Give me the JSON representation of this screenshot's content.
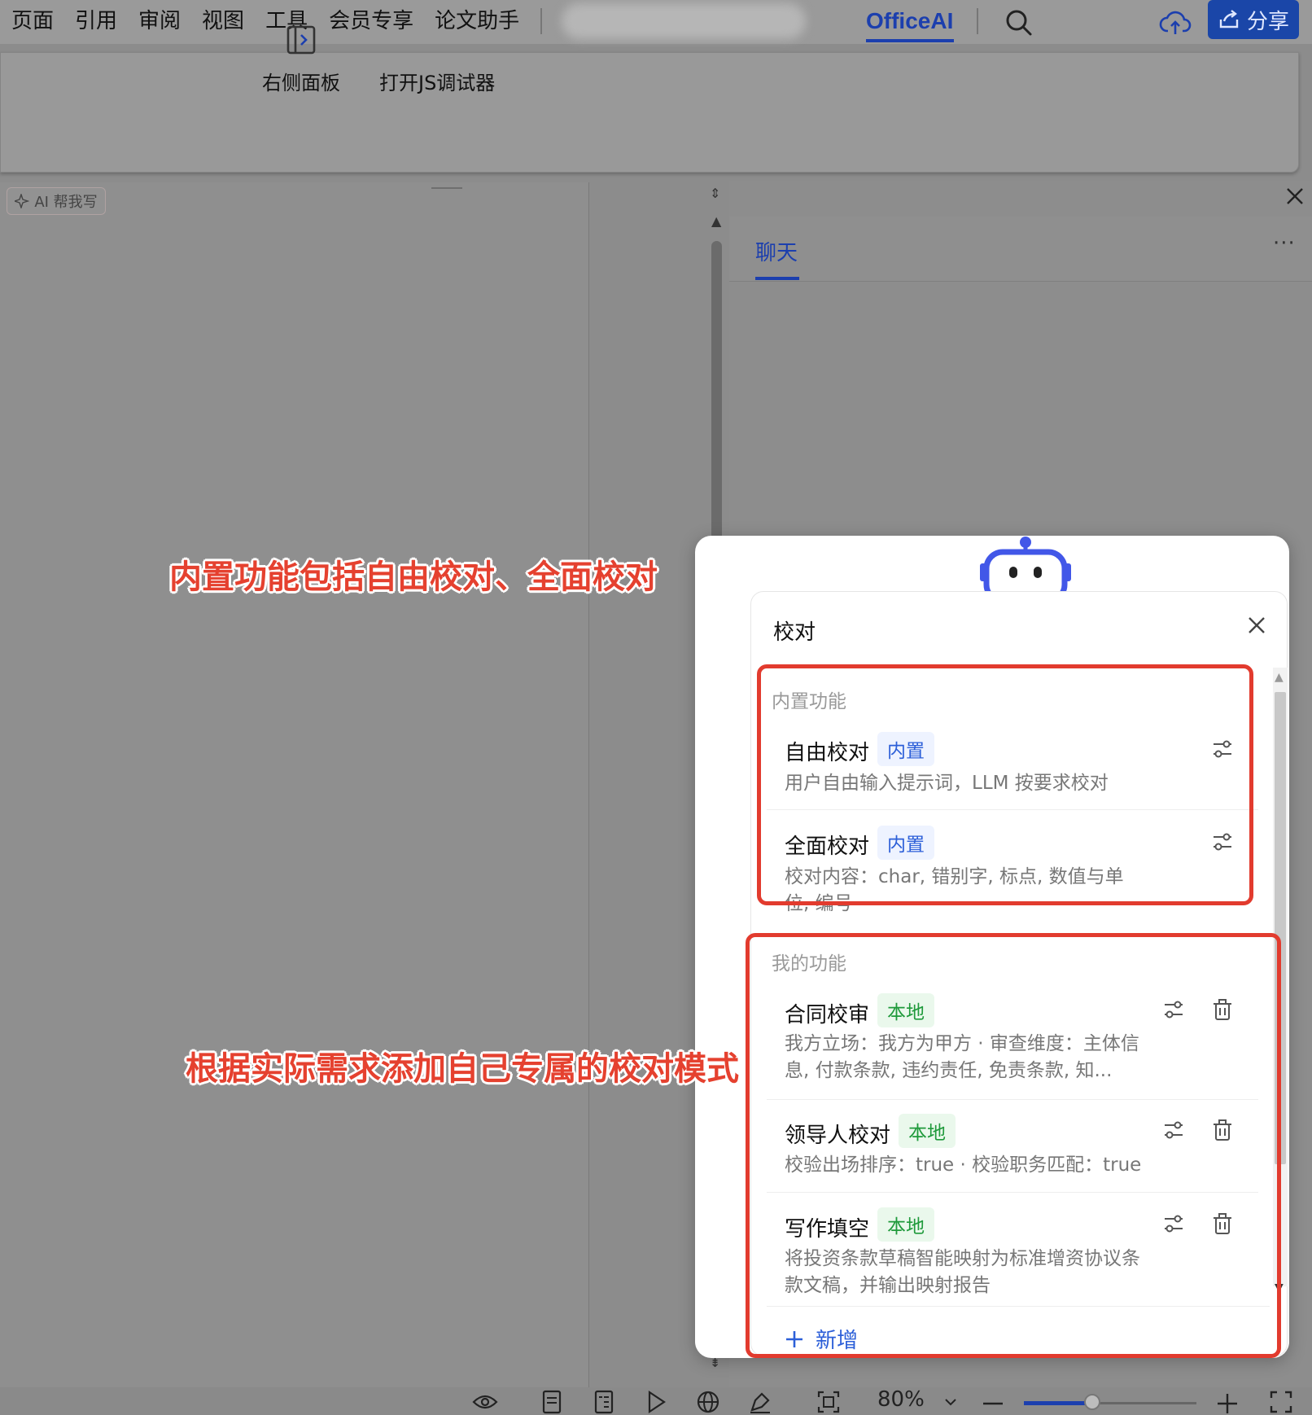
{
  "menubar": {
    "items": [
      "页面",
      "引用",
      "审阅",
      "视图",
      "工具",
      "会员专享",
      "论文助手"
    ],
    "active_tab": "OfficeAI",
    "share_label": "分享"
  },
  "ribbon": {
    "right_panel_label": "右侧面板",
    "js_debugger_label": "打开JS调试器"
  },
  "document": {
    "ai_write_label": "AI 帮我写"
  },
  "side_panel": {
    "chat_tab": "聊天",
    "more": "···"
  },
  "dialog": {
    "title": "校对",
    "builtin_section": "内置功能",
    "builtin_items": [
      {
        "name": "自由校对",
        "tag": "内置",
        "desc": "用户自由输入提示词，LLM 按要求校对"
      },
      {
        "name": "全面校对",
        "tag": "内置",
        "desc": "校对内容：char, 错别字, 标点, 数值与单位, 编号"
      }
    ],
    "mine_section": "我的功能",
    "mine_items": [
      {
        "name": "合同校审",
        "tag": "本地",
        "desc": "我方立场：我方为甲方 · 审查维度：主体信息, 付款条款, 违约责任, 免责条款, 知..."
      },
      {
        "name": "领导人校对",
        "tag": "本地",
        "desc": "校验出场排序：true · 校验职务匹配：true"
      },
      {
        "name": "写作填空",
        "tag": "本地",
        "desc": "将投资条款草稿智能映射为标准增资协议条款文稿，并输出映射报告"
      }
    ],
    "add_label": "新增"
  },
  "statusbar": {
    "zoom": "80%"
  },
  "annotations": {
    "builtin_note": "内置功能包括自由校对、全面校对",
    "custom_note": "根据实际需求添加自己专属的校对模式"
  },
  "colors": {
    "accent": "#1c3fae",
    "annotation_red": "#e23b2e",
    "builtin_tag": "#2c5fd8",
    "local_tag": "#1f9a3b"
  },
  "icons": [
    "search-icon",
    "cloud-upload-icon",
    "share-icon",
    "side-panel-icon",
    "close-icon",
    "robot-icon",
    "settings-sliders-icon",
    "trash-icon",
    "plus-icon",
    "eye-icon",
    "page-view-icon",
    "outline-icon",
    "play-icon",
    "globe-icon",
    "pen-icon",
    "fit-icon",
    "zoom-out-icon",
    "zoom-in-icon",
    "fullscreen-icon"
  ]
}
